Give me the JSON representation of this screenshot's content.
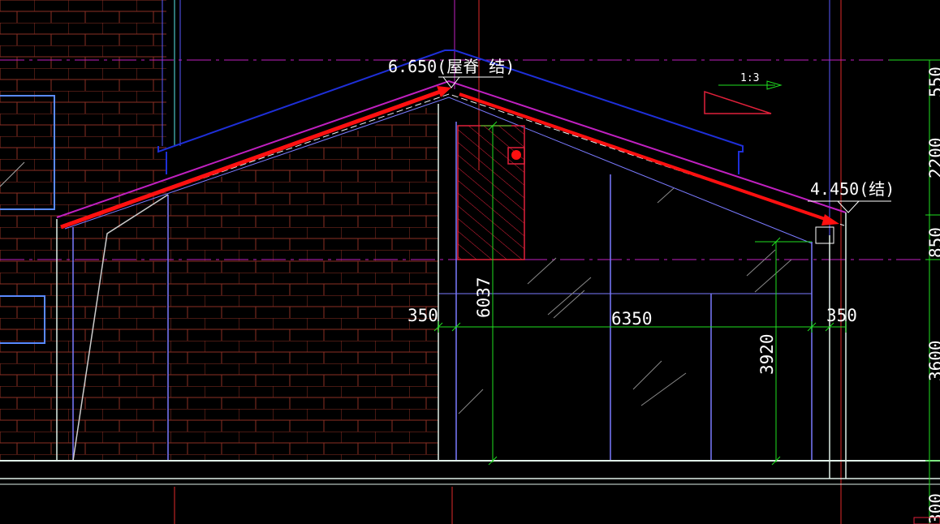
{
  "elevations": {
    "ridge": "6.650(屋脊 结)",
    "eave": "4.450(结)"
  },
  "slope_label": "1:3",
  "dimensions": {
    "left_wall": "350",
    "span": "6350",
    "right_wall": "350",
    "ridge_height": "6037",
    "window_height": "3920"
  },
  "right_ruler": {
    "d550": "550",
    "d2200": "2200",
    "d850": "850",
    "d3600": "3600",
    "d300": "300"
  },
  "colors": {
    "background": "#000000",
    "brick_hatch": "#8c2f23",
    "roof_outline": "#1e2fd8",
    "roof_line": "#c020c0",
    "annotation_arrow": "#ff1010",
    "dimension": "#20e020",
    "wall_line": "#7a7aff",
    "ground": "#e0f0e8",
    "text": "#ffffff"
  }
}
